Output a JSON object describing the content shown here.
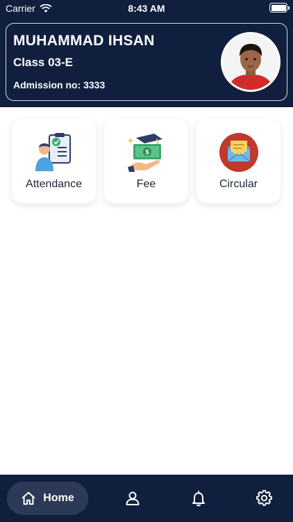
{
  "status_bar": {
    "carrier": "Carrier",
    "time": "8:43 AM",
    "wifi_icon": "wifi-icon",
    "battery_icon": "battery-icon"
  },
  "profile": {
    "name": "MUHAMMAD IHSAN",
    "class": "Class 03-E",
    "admission": "Admission no: 3333",
    "avatar_icon": "student-photo"
  },
  "tiles": [
    {
      "label": "Attendance",
      "icon": "attendance-icon"
    },
    {
      "label": "Fee",
      "icon": "fee-icon"
    },
    {
      "label": "Circular",
      "icon": "circular-icon"
    }
  ],
  "bottom_nav": {
    "home_label": "Home",
    "items": [
      "home-icon",
      "profile-icon",
      "notification-bell-icon",
      "settings-gear-icon"
    ]
  },
  "colors": {
    "header_bg": "#0f1f3d",
    "nav_active_bg": "#2c3a57",
    "circular_red": "#c0392b",
    "fee_green": "#3aa86b"
  }
}
